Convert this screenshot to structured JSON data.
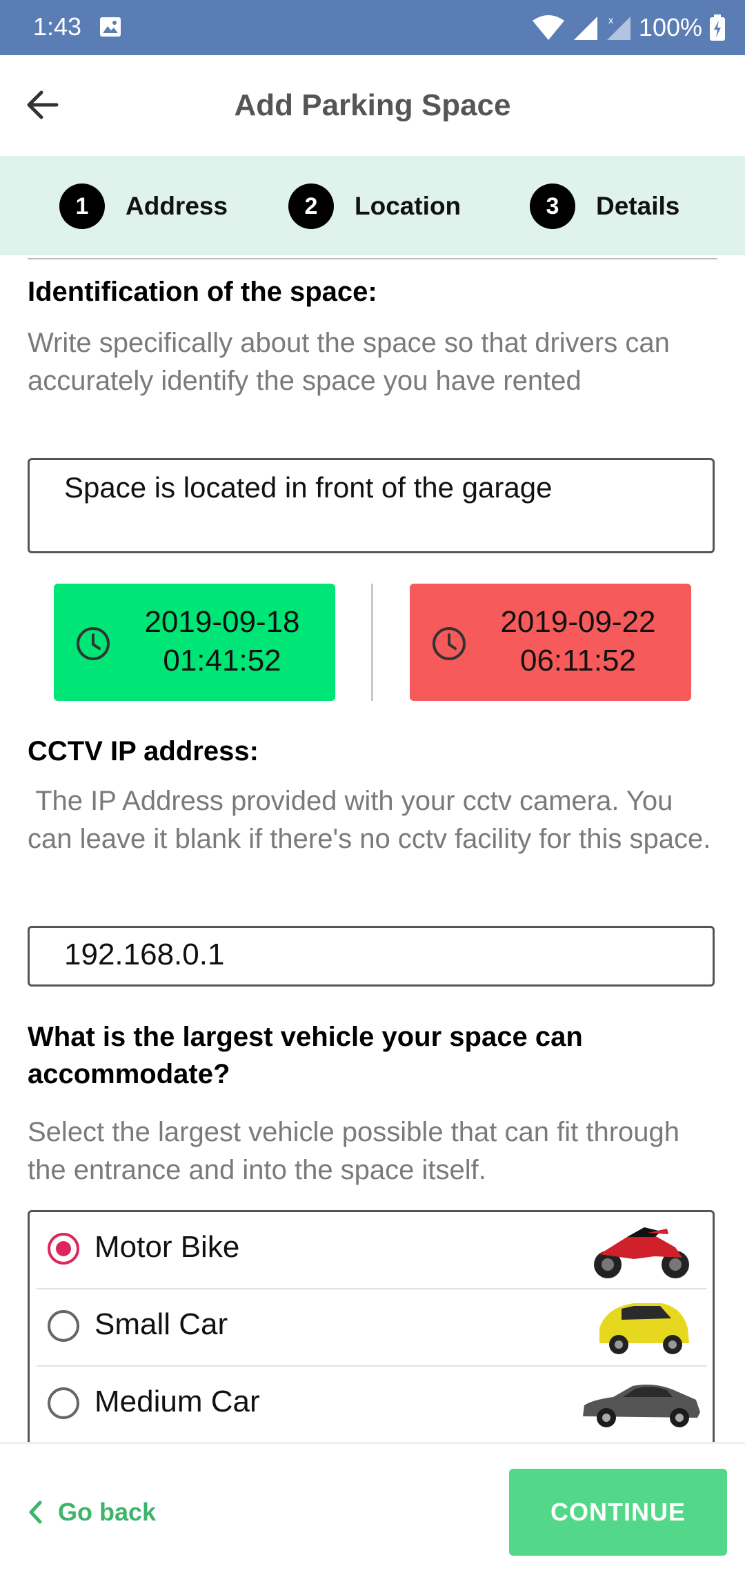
{
  "status_bar": {
    "time": "1:43",
    "battery": "100%"
  },
  "header": {
    "title": "Add Parking Space"
  },
  "stepper": {
    "steps": [
      {
        "number": "1",
        "label": "Address"
      },
      {
        "number": "2",
        "label": "Location"
      },
      {
        "number": "3",
        "label": "Details"
      }
    ]
  },
  "identification": {
    "heading": "Identification of the space:",
    "description": "Write specifically about the space so that drivers can accurately identify the space you have rented",
    "value": "Space is located in front of the garage"
  },
  "dates": {
    "start": {
      "date": "2019-09-18",
      "time": "01:41:52",
      "color": "#00e676"
    },
    "end": {
      "date": "2019-09-22",
      "time": "06:11:52",
      "color": "#f65a5a"
    }
  },
  "cctv": {
    "heading": "CCTV IP address:",
    "description": " The IP Address provided with your cctv camera. You can leave it blank if there's no cctv facility for this space.",
    "value": "192.168.0.1"
  },
  "vehicle": {
    "heading": "What is the largest vehicle your space can accommodate?",
    "description": "Select the largest vehicle possible that can fit through the entrance and into the space itself.",
    "options": [
      {
        "label": "Motor Bike",
        "selected": true,
        "image": "motorbike-image"
      },
      {
        "label": "Small Car",
        "selected": false,
        "image": "small-car-image"
      },
      {
        "label": "Medium Car",
        "selected": false,
        "image": "medium-car-image"
      }
    ]
  },
  "footer": {
    "back_label": "Go back",
    "continue_label": "CONTINUE"
  },
  "colors": {
    "primary": "#5b7db6",
    "accent_green": "#3cb56a",
    "radio_selected": "#e0245e"
  }
}
